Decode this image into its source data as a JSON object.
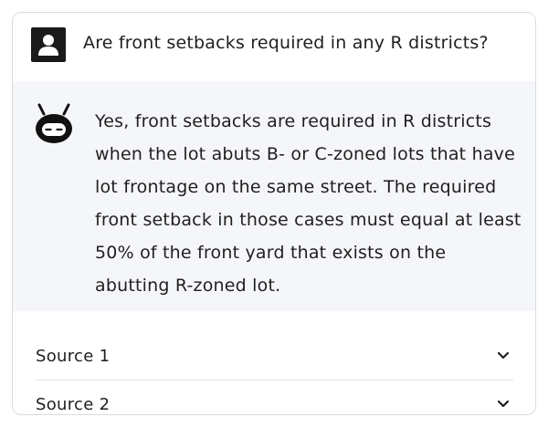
{
  "conversation": {
    "question": {
      "avatar_icon": "user-silhouette-icon",
      "text": "Are front setbacks required in any R districts?"
    },
    "answer": {
      "avatar_icon": "robot-face-icon",
      "text": "Yes, front setbacks are required in R districts when the lot abuts B- or C-zoned lots that have lot frontage on the same street. The required front setback in those cases must equal at least 50% of the front yard that exists on the abutting R-zoned lot."
    }
  },
  "sources": [
    {
      "label": "Source 1",
      "icon": "chevron-down-icon"
    },
    {
      "label": "Source 2",
      "icon": "chevron-down-icon"
    }
  ],
  "colors": {
    "answer_background": "#f4f6f9",
    "avatar": "#1a1a1a",
    "text": "#1f1f1f",
    "border": "#dcdcdc"
  }
}
